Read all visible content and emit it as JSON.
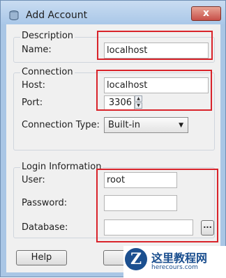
{
  "window": {
    "title": "Add Account",
    "close_glyph": "x"
  },
  "description": {
    "group_label": "Description",
    "name_label": "Name:",
    "name_value": "localhost"
  },
  "connection": {
    "group_label": "Connection",
    "host_label": "Host:",
    "host_value": "localhost",
    "port_label": "Port:",
    "port_value": "3306",
    "type_label": "Connection Type:",
    "type_value": "Built-in"
  },
  "login": {
    "group_label": "Login Information",
    "user_label": "User:",
    "user_value": "root",
    "password_label": "Password:",
    "password_value": "",
    "database_label": "Database:",
    "database_value": "",
    "browse_label": "..."
  },
  "buttons": {
    "help": "Help"
  },
  "watermark": {
    "logo_letter": "Z",
    "title": "这里教程网",
    "url": "herecours.com"
  },
  "colors": {
    "highlight": "#d9232a",
    "close": "#c75049"
  }
}
